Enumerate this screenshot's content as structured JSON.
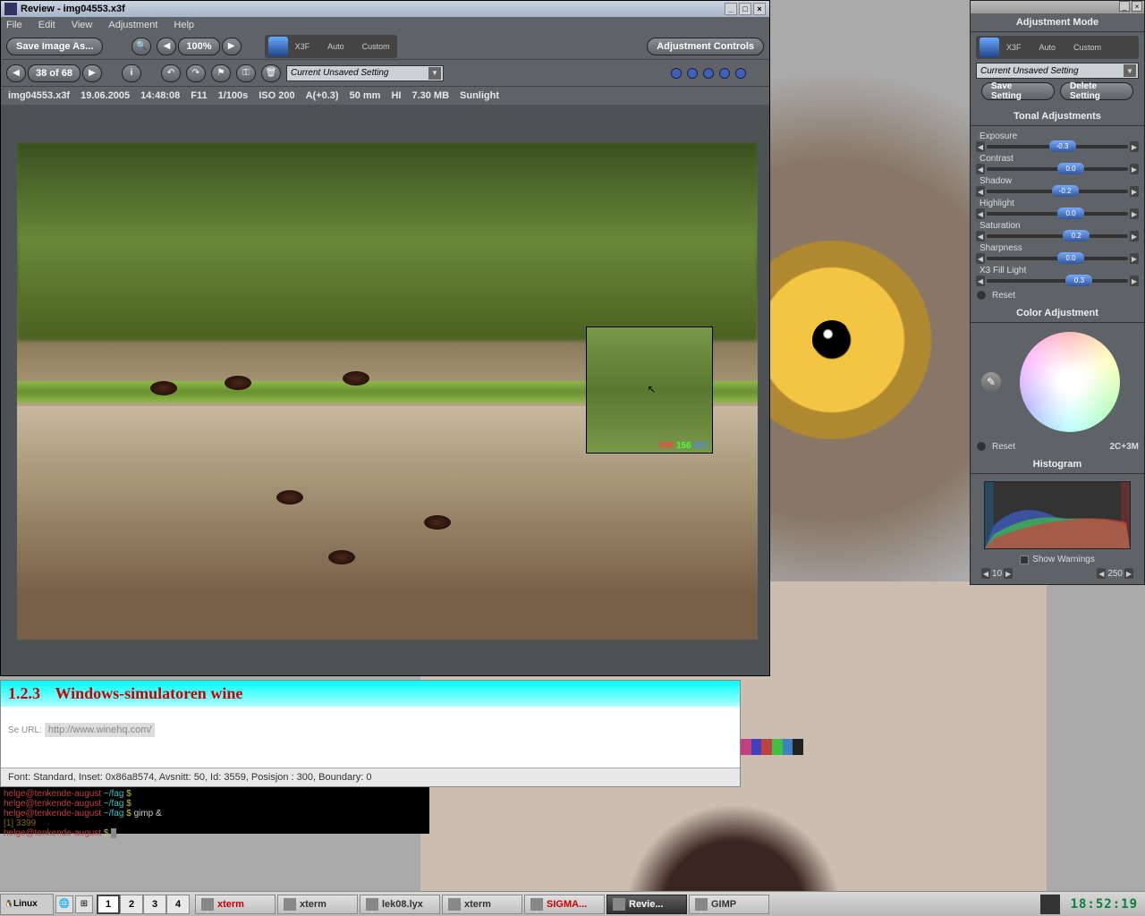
{
  "review": {
    "title": "Review - img04553.x3f",
    "menu": [
      "File",
      "Edit",
      "View",
      "Adjustment",
      "Help"
    ],
    "save_as": "Save Image As...",
    "zoom": "100%",
    "nav": "38 of 68",
    "adj_ctrl": "Adjustment Controls",
    "mode_labels": [
      "X3F",
      "Auto",
      "Custom"
    ],
    "setting": "Current Unsaved Setting",
    "info": {
      "file": "img04553.x3f",
      "date": "19.06.2005",
      "time": "14:48:08",
      "aperture": "F11",
      "shutter": "1/100s",
      "iso": "ISO 200",
      "ev": "A(+0.3)",
      "focal": "50 mm",
      "quality": "HI",
      "size": "7.30 MB",
      "wb": "Sunlight"
    },
    "loupe": {
      "r": "098",
      "g": "156",
      "b": "037"
    }
  },
  "adj": {
    "title": "Adjustment Mode",
    "mode_labels": [
      "X3F",
      "Auto",
      "Custom"
    ],
    "setting": "Current Unsaved Setting",
    "save": "Save Setting",
    "delete": "Delete Setting",
    "tonal_title": "Tonal Adjustments",
    "sliders": [
      {
        "label": "Exposure",
        "val": "-0.3",
        "pos": 44
      },
      {
        "label": "Contrast",
        "val": "0.0",
        "pos": 50
      },
      {
        "label": "Shadow",
        "val": "-0.2",
        "pos": 46
      },
      {
        "label": "Highlight",
        "val": "0.0",
        "pos": 50
      },
      {
        "label": "Saturation",
        "val": "0.2",
        "pos": 54
      },
      {
        "label": "Sharpness",
        "val": "0.0",
        "pos": 50
      },
      {
        "label": "X3 Fill Light",
        "val": "0.3",
        "pos": 56
      }
    ],
    "reset": "Reset",
    "color_title": "Color Adjustment",
    "color_val": "2C+3M",
    "hist_title": "Histogram",
    "show_warn": "Show Warnings",
    "hist_lo": "10",
    "hist_hi": "250"
  },
  "editor": {
    "num": "1.2.3",
    "title": "Windows-simulatoren wine",
    "url": "http://www.winehq.com/",
    "status": "Font: Standard, Inset: 0x86a8574, Avsnitt: 50, Id: 3559, Posisjon : 300, Boundary: 0"
  },
  "terminal": {
    "user": "helge@tenkende-august",
    "path": "~/fag",
    "cmd": "gimp &",
    "job": "[1] 3399"
  },
  "taskbar": {
    "start": "Linux",
    "desks": [
      "1",
      "2",
      "3",
      "4"
    ],
    "tasks": [
      {
        "label": "xterm",
        "color": "#c00"
      },
      {
        "label": "xterm",
        "color": "#333"
      },
      {
        "label": "lek08.lyx",
        "color": "#333"
      },
      {
        "label": "xterm",
        "color": "#333"
      },
      {
        "label": "SIGMA...",
        "color": "#c00"
      },
      {
        "label": "Revie...",
        "color": "#fff",
        "active": true
      },
      {
        "label": "GIMP",
        "color": "#333"
      }
    ],
    "clock": "18:52:19"
  }
}
